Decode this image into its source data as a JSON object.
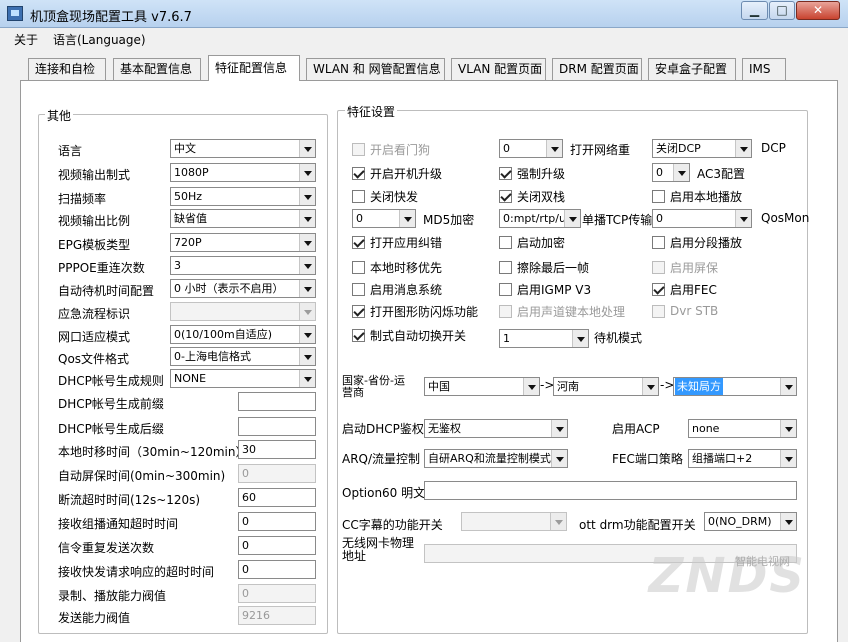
{
  "window": {
    "title": "机顶盒现场配置工具 v7.6.7"
  },
  "menu": [
    "关于",
    "语言(Language)"
  ],
  "tabs": [
    "连接和自检",
    "基本配置信息",
    "特征配置信息",
    "WLAN 和 网管配置信息",
    "VLAN 配置页面",
    "DRM 配置页面",
    "安卓盒子配置",
    "IMS"
  ],
  "other_group": {
    "title": "其他",
    "fields": [
      {
        "label": "语言",
        "kind": "combo",
        "value": "中文"
      },
      {
        "label": "视频输出制式",
        "kind": "combo",
        "value": "1080P"
      },
      {
        "label": "扫描频率",
        "kind": "combo",
        "value": "50Hz"
      },
      {
        "label": "视频输出比例",
        "kind": "combo",
        "value": "缺省值"
      },
      {
        "label": "EPG模板类型",
        "kind": "combo",
        "value": "720P"
      },
      {
        "label": "PPPOE重连次数",
        "kind": "combo",
        "value": "3"
      },
      {
        "label": "自动待机时间配置",
        "kind": "combo",
        "value": "0 小时（表示不启用）"
      },
      {
        "label": "应急流程标识",
        "kind": "combo-disabled",
        "value": ""
      },
      {
        "label": "网口适应模式",
        "kind": "combo",
        "value": "0(10/100m自适应)"
      },
      {
        "label": "Qos文件格式",
        "kind": "combo",
        "value": "0-上海电信格式"
      },
      {
        "label": "DHCP帐号生成规则",
        "kind": "combo",
        "value": "NONE"
      },
      {
        "label": "DHCP帐号生成前缀",
        "kind": "edit",
        "value": ""
      },
      {
        "label": "DHCP帐号生成后缀",
        "kind": "edit",
        "value": ""
      },
      {
        "label": "本地时移时间（30min~120min）",
        "kind": "edit",
        "value": "30"
      },
      {
        "label": "自动屏保时间(0min~300min)",
        "kind": "edit-disabled",
        "value": "0"
      },
      {
        "label": "断流超时时间(12s~120s)",
        "kind": "edit",
        "value": "60"
      },
      {
        "label": "接收组播通知超时时间",
        "kind": "edit",
        "value": "0"
      },
      {
        "label": "信令重复发送次数",
        "kind": "edit",
        "value": "0"
      },
      {
        "label": "接收快发请求响应的超时时间",
        "kind": "edit",
        "value": "0"
      },
      {
        "label": "录制、播放能力阀值",
        "kind": "edit-disabled",
        "value": "0"
      },
      {
        "label": "发送能力阀值",
        "kind": "edit-disabled",
        "value": "9216"
      }
    ]
  },
  "feature_group": {
    "title": "特征设置",
    "col1": [
      {
        "label": "开启看门狗",
        "checked": false,
        "disabled": true
      },
      {
        "label": "开启开机升级",
        "checked": true,
        "disabled": false
      },
      {
        "label": "关闭快发",
        "checked": false,
        "disabled": false
      },
      {
        "label": "MD5加密",
        "combo": "0"
      },
      {
        "label": "打开应用纠错",
        "checked": true,
        "disabled": false
      },
      {
        "label": "本地时移优先",
        "checked": false,
        "disabled": false
      },
      {
        "label": "启用消息系统",
        "checked": false,
        "disabled": false
      },
      {
        "label": "打开图形防闪烁功能",
        "checked": true,
        "disabled": false
      },
      {
        "label": "制式自动切换开关",
        "checked": true,
        "disabled": false
      }
    ],
    "col2": [
      {
        "label": "打开网络重",
        "combo": "0"
      },
      {
        "label": "强制升级",
        "checked": true,
        "disabled": false
      },
      {
        "label": "关闭双栈",
        "checked": true,
        "disabled": false
      },
      {
        "label": "单播TCP传输",
        "combo": "0:mpt/rtp/udp"
      },
      {
        "label": "启动加密",
        "checked": false,
        "disabled": false
      },
      {
        "label": "擦除最后一帧",
        "checked": false,
        "disabled": false
      },
      {
        "label": "启用IGMP V3",
        "checked": false,
        "disabled": false
      },
      {
        "label": "启用声道键本地处理",
        "checked": false,
        "disabled": true
      },
      {
        "label": "待机模式",
        "combo": "1"
      }
    ],
    "col3": [
      {
        "label": "DCP",
        "combo": "关闭DCP"
      },
      {
        "label": "AC3配置",
        "combo": "0"
      },
      {
        "label": "启用本地播放",
        "checked": false,
        "disabled": false
      },
      {
        "label": "QosMon",
        "combo": "0"
      },
      {
        "label": "启用分段播放",
        "checked": false,
        "disabled": false
      },
      {
        "label": "启用屏保",
        "checked": false,
        "disabled": true
      },
      {
        "label": "启用FEC",
        "checked": true,
        "disabled": false
      },
      {
        "label": "Dvr STB",
        "checked": false,
        "disabled": true
      }
    ],
    "region_label": "国家-省份-运营商",
    "country": "中国",
    "province": "河南",
    "operator": "未知局方",
    "arrow": "->",
    "dhcp_label": "启动DHCP鉴权",
    "dhcp_value": "无鉴权",
    "acp_label": "启用ACP",
    "acp_value": "none",
    "arq_label": "ARQ/流量控制",
    "arq_value": "自研ARQ和流量控制模式",
    "fec_label": "FEC端口策略",
    "fec_value": "组播端口+2",
    "opt60_label": "Option60 明文",
    "opt60_value": "",
    "cc_label": "CC字幕的功能开关",
    "cc_value": "",
    "drm_label": "ott drm功能配置开关",
    "drm_value": "0(NO_DRM)",
    "wifi_label": "无线网卡物理地址",
    "wifi_value": ""
  },
  "watermark": {
    "text": "ZNDS",
    "sub": "智能电视网"
  },
  "colors": {
    "title_bar": "#c4daf2",
    "selection": "#3399ff",
    "close": "#c8432f"
  }
}
